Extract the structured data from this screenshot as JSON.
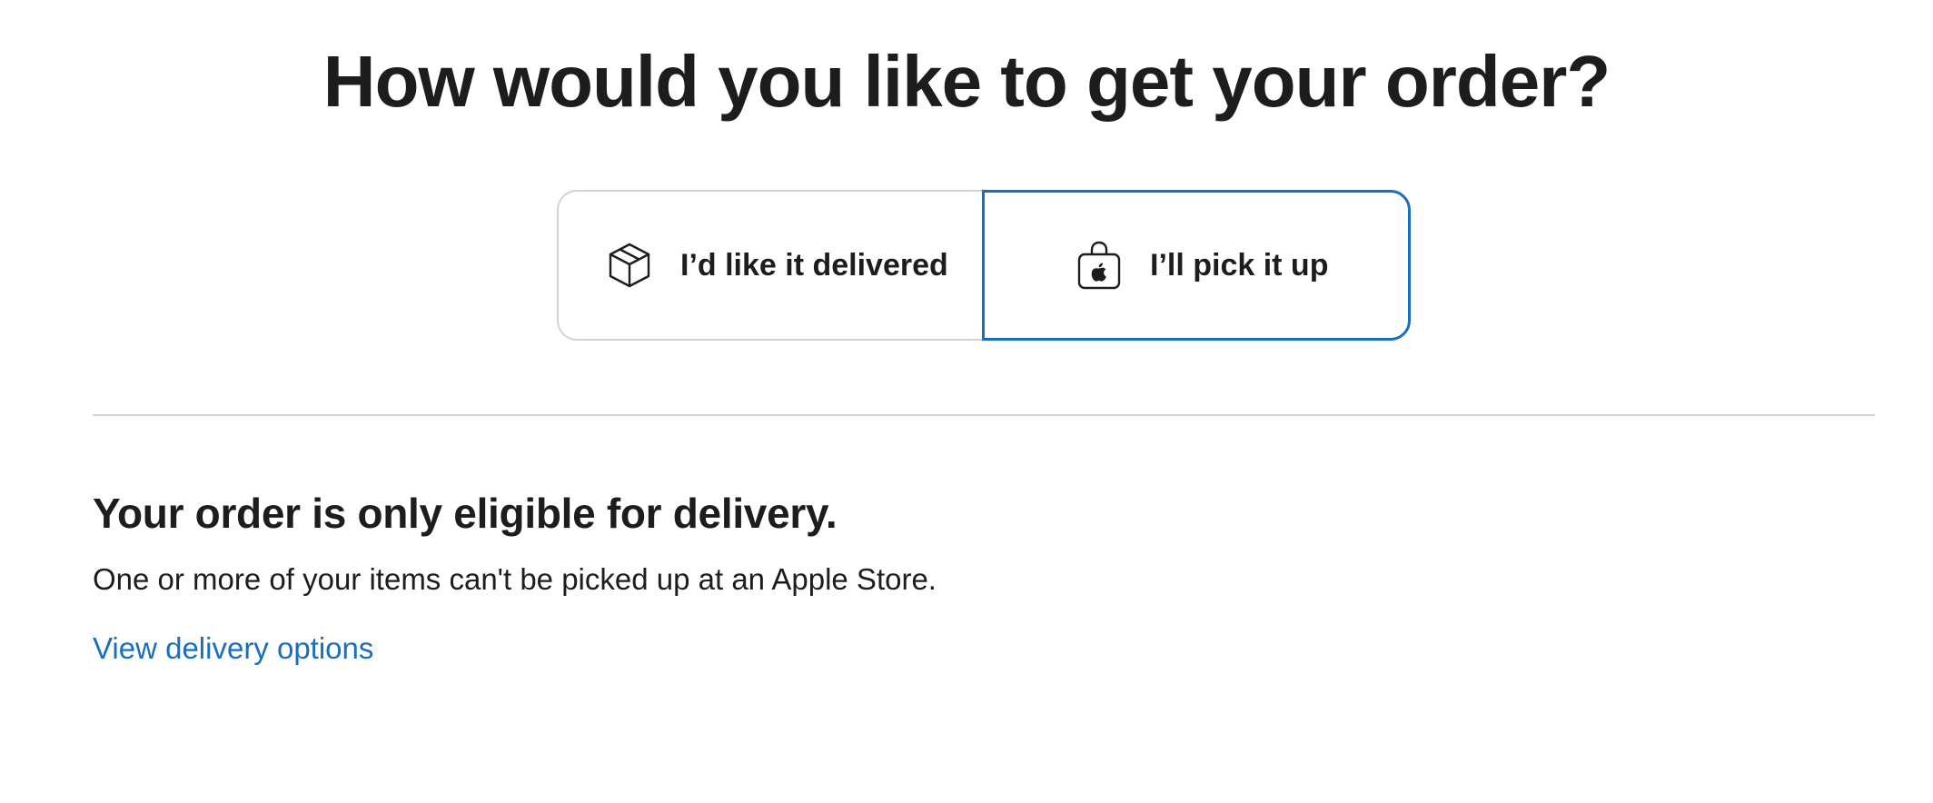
{
  "page": {
    "headline": "How would you like to get your order?"
  },
  "fulfillment_options": {
    "selected": "pickup",
    "accent_color": "#1a6ec0",
    "delivery": {
      "label": "I’d like it delivered",
      "icon": "box-icon"
    },
    "pickup": {
      "label": "I’ll pick it up",
      "icon": "apple-bag-icon"
    }
  },
  "notice": {
    "title": "Your order is only eligible for delivery.",
    "body": "One or more of your items can't be picked up at an Apple Store.",
    "link_label": "View delivery options"
  }
}
